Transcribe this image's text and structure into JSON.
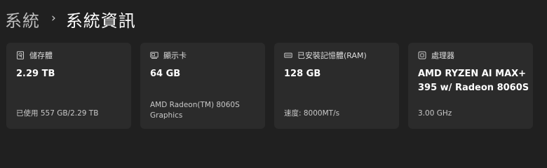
{
  "breadcrumb": {
    "parent": "系統",
    "separator": "›",
    "current": "系統資訊"
  },
  "cards": [
    {
      "icon": "storage-icon",
      "title": "儲存體",
      "value": "2.29 TB",
      "detail": "已使用 557 GB/2.29 TB"
    },
    {
      "icon": "display-adapter-icon",
      "title": "顯示卡",
      "value": "64 GB",
      "detail": "AMD Radeon(TM) 8060S Graphics"
    },
    {
      "icon": "memory-icon",
      "title": "已安裝記憶體(RAM)",
      "value": "128 GB",
      "detail": "速度: 8000MT/s"
    },
    {
      "icon": "processor-icon",
      "title": "處理器",
      "value": "AMD RYZEN AI MAX+ 395 w/ Radeon 8060S",
      "detail": "3.00 GHz"
    }
  ]
}
